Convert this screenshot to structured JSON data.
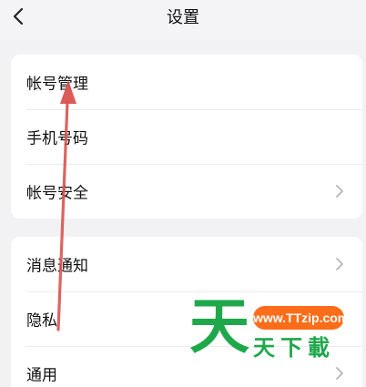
{
  "header": {
    "title": "设置",
    "back_icon": "chevron-left-icon"
  },
  "groups": [
    {
      "items": [
        {
          "label": "帐号管理",
          "has_chevron": false
        },
        {
          "label": "手机号码",
          "has_chevron": false
        },
        {
          "label": "帐号安全",
          "has_chevron": true
        }
      ]
    },
    {
      "items": [
        {
          "label": "消息通知",
          "has_chevron": true
        },
        {
          "label": "隐私",
          "has_chevron": false
        },
        {
          "label": "通用",
          "has_chevron": true
        }
      ]
    }
  ],
  "annotation": {
    "color": "#d9534f"
  },
  "watermark": {
    "big": "天",
    "site": "www.TTzip.com",
    "sub": "天下載",
    "green": "#1ea84a",
    "orange": "#ff6d1a"
  }
}
